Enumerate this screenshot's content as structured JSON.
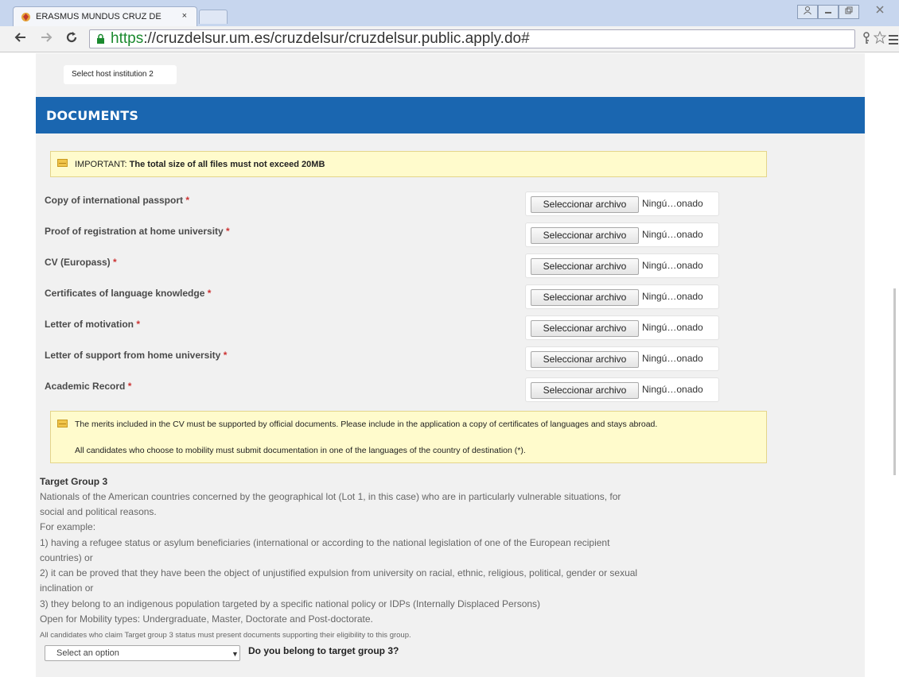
{
  "browser": {
    "tab_title": "ERASMUS MUNDUS CRUZ DE",
    "tab_close": "×",
    "url_scheme": "https",
    "url_rest": "://cruzdelsur.um.es/cruzdelsur/cruzdelsur.public.apply.do#"
  },
  "host_tab": {
    "label": "Select host institution 2"
  },
  "documents": {
    "title": "DOCUMENTS",
    "notice_prefix": "IMPORTANT:",
    "notice_bold": "The total size of all files must not exceed 20MB",
    "required_mark": "*",
    "file_button_label": "Seleccionar archivo",
    "file_status": "Ningú…onado",
    "rows": [
      {
        "label": "Copy of international passport"
      },
      {
        "label": "Proof of registration at home university"
      },
      {
        "label": "CV (Europass)"
      },
      {
        "label": "Certificates of language knowledge"
      },
      {
        "label": "Letter of motivation"
      },
      {
        "label": "Letter of support from home university"
      },
      {
        "label": "Academic Record"
      }
    ],
    "notice2_line1": "The merits included in the CV must be supported by official documents. Please include in the application a copy of certificates of languages and stays abroad.",
    "notice2_line2": "All candidates who choose to mobility must submit documentation in one of the languages of the country of destination (*)."
  },
  "target_group": {
    "title": "Target Group 3",
    "lines": [
      "Nationals of the American countries concerned by the geographical lot (Lot 1, in this case) who are in particularly vulnerable situations, for",
      "social and political reasons.",
      "For example:",
      "1) having a refugee status or asylum beneficiaries (international or according to the national legislation of one of the European recipient",
      "countries) or",
      "2) it can be proved that they have been the object of unjustified expulsion from university on racial, ethnic, religious, political, gender or sexual",
      "inclination or",
      "3) they belong to an indigenous population targeted by a specific national policy or IDPs (Internally Displaced Persons)",
      "Open for Mobility types: Undergraduate, Master, Doctorate and Post-doctorate."
    ],
    "small_note": "All candidates who claim Target group 3 status must present documents supporting their eligibility to this group.",
    "select_value": "Select an option",
    "select_question": "Do you belong to target group 3?"
  }
}
